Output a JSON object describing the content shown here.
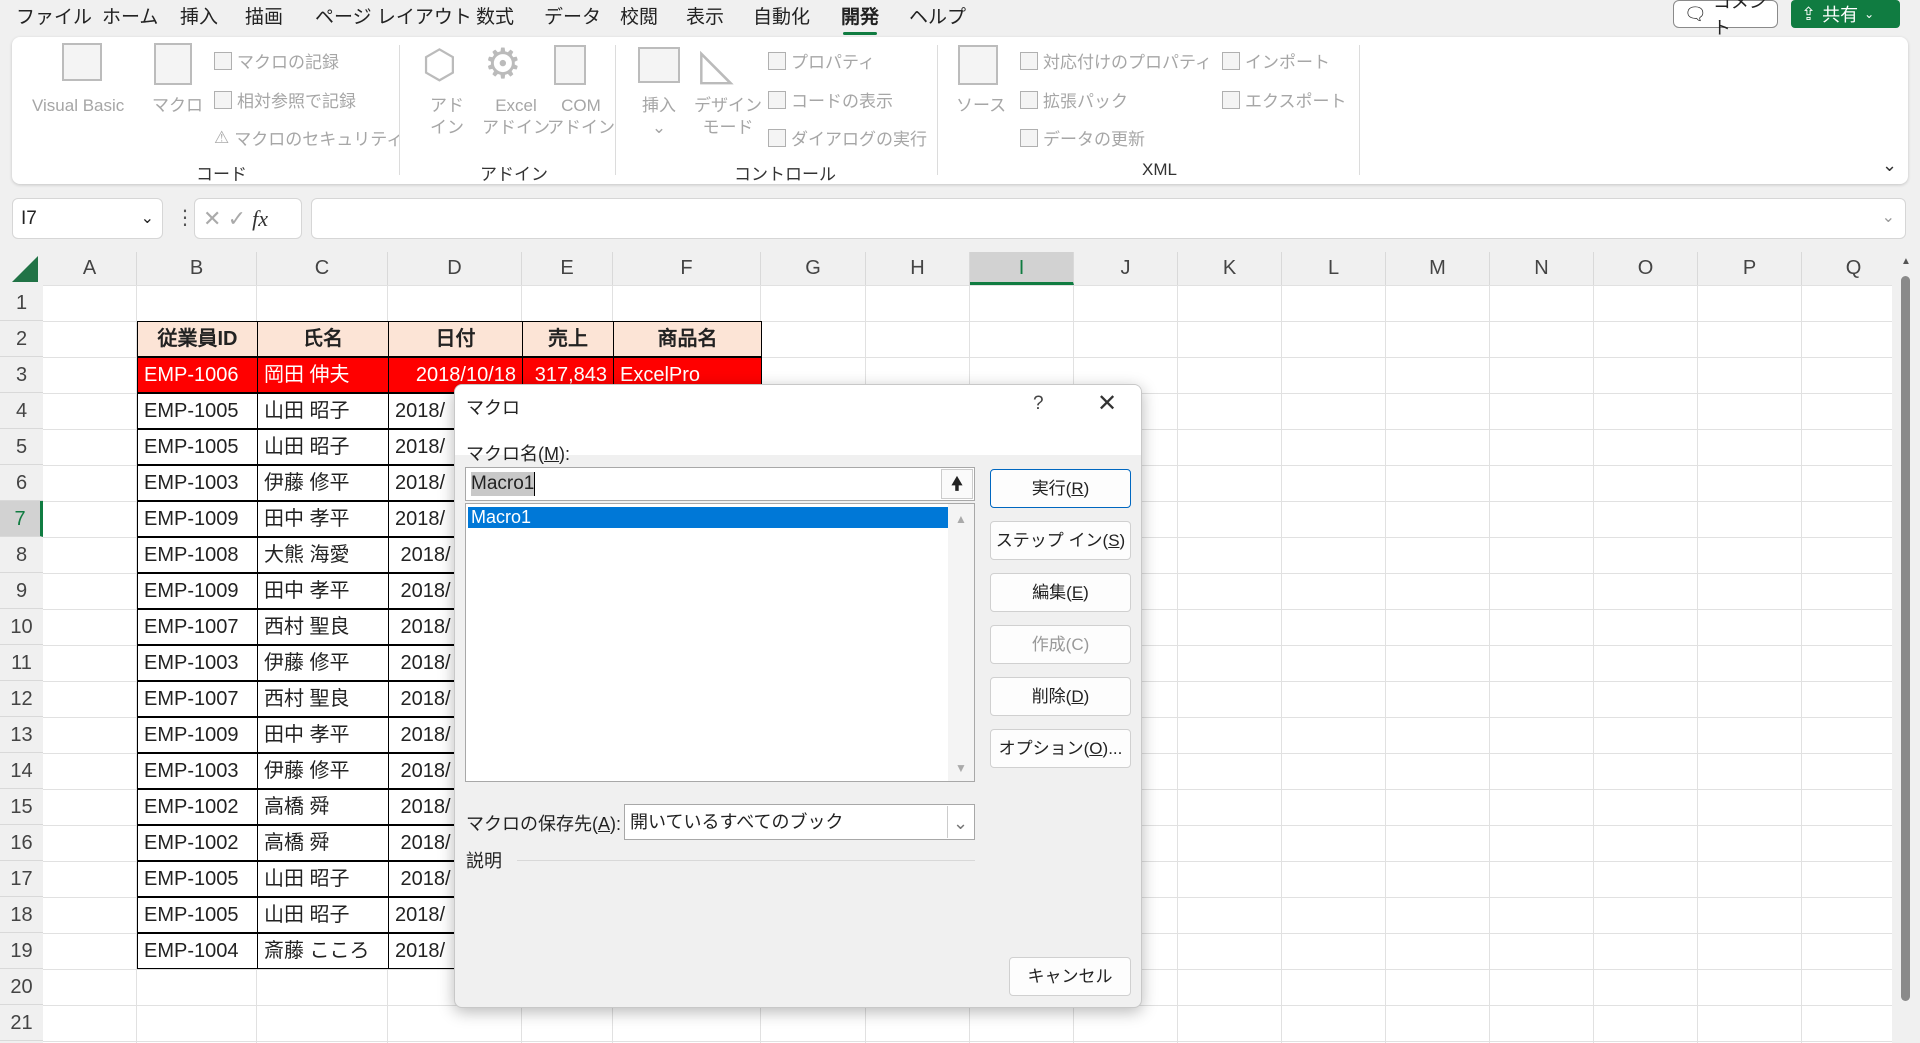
{
  "menu": {
    "tabs": [
      "ファイル",
      "ホーム",
      "挿入",
      "描画",
      "ページ レイアウト",
      "数式",
      "データ",
      "校閲",
      "表示",
      "自動化",
      "開発",
      "ヘルプ"
    ],
    "active": "開発",
    "comment": "コメント",
    "share": "共有"
  },
  "ribbon": {
    "code": {
      "label": "コード",
      "visual_basic": "Visual Basic",
      "macro": "マクロ",
      "record": "マクロの記録",
      "relative": "相対参照で記録",
      "security": "マクロのセキュリティ"
    },
    "addin": {
      "label": "アドイン",
      "addin1": "アド",
      "addin2": "イン",
      "excel1": "Excel",
      "excel2": "アドイン",
      "com1": "COM",
      "com2": "アドイン"
    },
    "control": {
      "label": "コントロール",
      "insert": "挿入",
      "design1": "デザイン",
      "design2": "モード",
      "properties": "プロパティ",
      "view_code": "コードの表示",
      "run_dialog": "ダイアログの実行"
    },
    "xml": {
      "label": "XML",
      "source": "ソース",
      "map_props": "対応付けのプロパティ",
      "expansion": "拡張パック",
      "refresh": "データの更新",
      "import": "インポート",
      "export": "エクスポート"
    }
  },
  "formula_bar": {
    "name_box": "I7",
    "value": ""
  },
  "columns": [
    "A",
    "B",
    "C",
    "D",
    "E",
    "F",
    "G",
    "H",
    "I",
    "J",
    "K",
    "L",
    "M",
    "N",
    "O",
    "P",
    "Q"
  ],
  "selected_column": "I",
  "selected_row": "7",
  "rows": [
    "1",
    "2",
    "3",
    "4",
    "5",
    "6",
    "7",
    "8",
    "9",
    "10",
    "11",
    "12",
    "13",
    "14",
    "15",
    "16",
    "17",
    "18",
    "19",
    "20",
    "21"
  ],
  "table": {
    "headers": [
      "従業員ID",
      "氏名",
      "日付",
      "売上",
      "商品名"
    ],
    "highlight_row": [
      "EMP-1006",
      "岡田 伸夫",
      "2018/10/18",
      "317,843",
      "ExcelPro"
    ],
    "rows": [
      [
        "EMP-1005",
        "山田 昭子",
        "2018/"
      ],
      [
        "EMP-1005",
        "山田 昭子",
        "2018/"
      ],
      [
        "EMP-1003",
        "伊藤 修平",
        "2018/"
      ],
      [
        "EMP-1009",
        "田中 孝平",
        "2018/"
      ],
      [
        "EMP-1008",
        "大熊 海愛",
        " 2018/"
      ],
      [
        "EMP-1009",
        "田中 孝平",
        " 2018/"
      ],
      [
        "EMP-1007",
        "西村 聖良",
        " 2018/"
      ],
      [
        "EMP-1003",
        "伊藤 修平",
        " 2018/"
      ],
      [
        "EMP-1007",
        "西村 聖良",
        " 2018/"
      ],
      [
        "EMP-1009",
        "田中 孝平",
        " 2018/"
      ],
      [
        "EMP-1003",
        "伊藤 修平",
        " 2018/"
      ],
      [
        "EMP-1002",
        "高橋 舜",
        " 2018/"
      ],
      [
        "EMP-1002",
        "高橋 舜",
        " 2018/"
      ],
      [
        "EMP-1005",
        "山田 昭子",
        " 2018/"
      ],
      [
        "EMP-1005",
        "山田 昭子",
        "2018/"
      ],
      [
        "EMP-1004",
        "斎藤 こころ",
        "2018/"
      ]
    ],
    "colors": {
      "header_bg": "#fce4d6",
      "highlight_bg": "#ff0000"
    }
  },
  "dialog": {
    "title": "マクロ",
    "help": "?",
    "name_label": "マクロ名(",
    "name_key": "M",
    "name_end": "):",
    "name_value": "Macro1",
    "macros": [
      "Macro1"
    ],
    "buttons": {
      "run": [
        "実行(",
        "R",
        ")"
      ],
      "step": [
        "ステップ イン(",
        "S",
        ")"
      ],
      "edit": [
        "編集(",
        "E",
        ")"
      ],
      "create": "作成(C)",
      "delete": [
        "削除(",
        "D",
        ")"
      ],
      "options": [
        "オプション(",
        "O",
        ")..."
      ],
      "cancel": "キャンセル"
    },
    "store_label": "マクロの保存先(",
    "store_key": "A",
    "store_end": "):",
    "store_value": "開いているすべてのブック",
    "description": "説明"
  },
  "colors": {
    "accent": "#107c41",
    "selection": "#0078d7"
  }
}
